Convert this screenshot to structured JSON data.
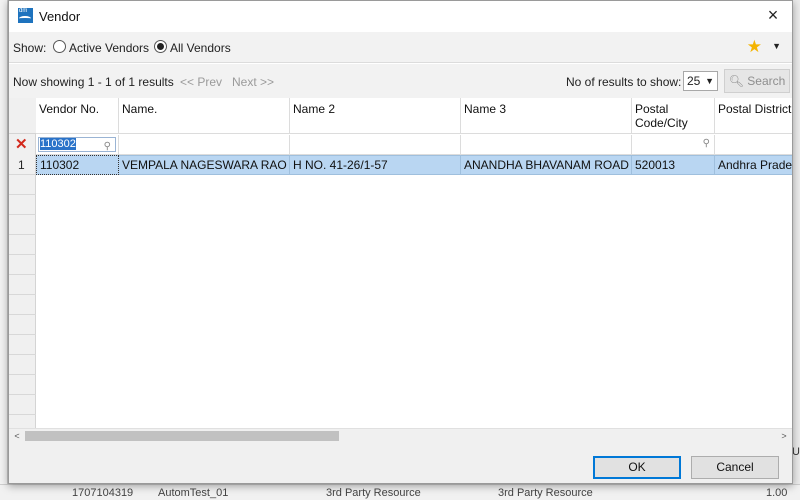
{
  "dialog": {
    "title": "Vendor",
    "close_icon": "×"
  },
  "toolbar": {
    "show_label": "Show:",
    "options": [
      {
        "label": "Active Vendors",
        "selected": false
      },
      {
        "label": "All Vendors",
        "selected": true
      }
    ],
    "favorites_icon": "star-icon"
  },
  "pager": {
    "showing_text": "Now showing 1 - 1 of 1 results",
    "prev_label": "<< Prev",
    "next_label": "Next >>",
    "results_label": "No of results to show:",
    "results_value": "25",
    "search_label": "Search"
  },
  "grid": {
    "columns": [
      "Vendor No.",
      "Name.",
      "Name 2",
      "Name 3",
      "Postal Code/City",
      "Postal District"
    ],
    "filter_value": "110302",
    "rows": [
      {
        "num": "1",
        "cells": [
          "110302",
          "VEMPALA NAGESWARA RAO",
          "H NO. 41-26/1-57",
          "ANANDHA BHAVANAM ROAD",
          "520013",
          "Andhra Pradesh"
        ]
      }
    ]
  },
  "buttons": {
    "ok_label": "OK",
    "cancel_label": "Cancel"
  },
  "background": {
    "bottom_cells": [
      "1707104319",
      "AutomTest_01",
      "3rd Party Resource",
      "3rd Party Resource"
    ],
    "right_value": "U",
    "right_bottom": "1.00"
  },
  "colors": {
    "accent": "#0078d7",
    "selection": "#b9d6f2",
    "star": "#f4b400",
    "clear_filter": "#d3291c"
  }
}
